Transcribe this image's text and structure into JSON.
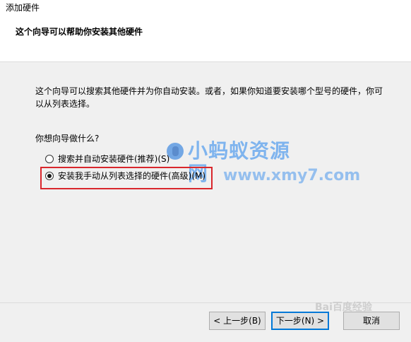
{
  "window": {
    "title": "添加硬件"
  },
  "header": {
    "title": "这个向导可以帮助你安装其他硬件"
  },
  "main": {
    "description": "这个向导可以搜索其他硬件并为你自动安装。或者，如果你知道要安装哪个型号的硬件，你可以从列表选择。",
    "question": "你想向导做什么?",
    "options": [
      {
        "label": "搜索并自动安装硬件(推荐)(S)",
        "checked": false
      },
      {
        "label": "安装我手动从列表选择的硬件(高级)(M)",
        "checked": true
      }
    ]
  },
  "watermark": {
    "title": "小蚂蚁资源网",
    "url": "www.xmy7.com",
    "baidu": "Bai百度经验"
  },
  "footer": {
    "back_label": "< 上一步(B)",
    "next_label": "下一步(N) >",
    "cancel_label": "取消"
  },
  "colors": {
    "highlight": "#d9262c",
    "watermark": "#5aa0ee",
    "default_button_border": "#0078d7"
  }
}
